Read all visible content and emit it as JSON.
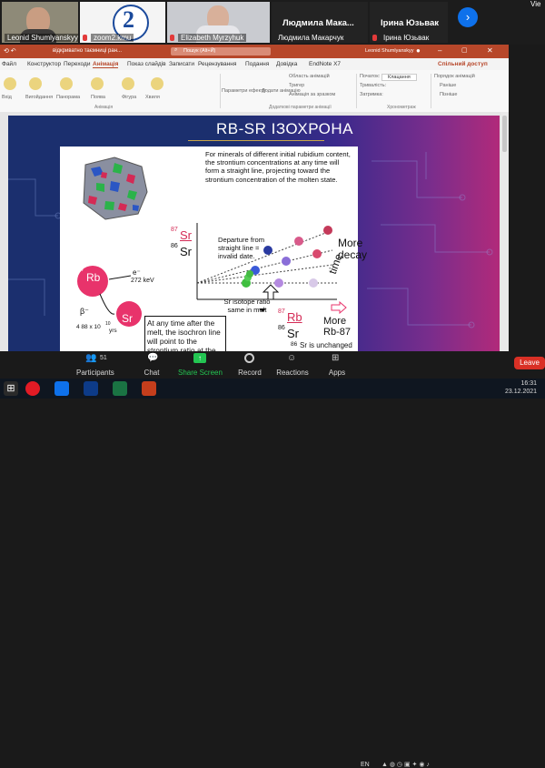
{
  "gallery": {
    "participants": [
      {
        "name": "Leonid Shumlyanskyy"
      },
      {
        "name": "zoom2.kmu"
      },
      {
        "name": "Elizabeth Myrzyhuk"
      },
      {
        "name": "Людмила Макарчук",
        "caption": "Людмила  Мака..."
      },
      {
        "name": "Ірина Юзьвак",
        "caption": "Ірина Юзьвак"
      }
    ],
    "next_label": "›",
    "view_label": "Vie"
  },
  "ppt": {
    "title": "відкриватно таємниці ран...",
    "saved_label": "Пошук (Alt+Й)",
    "user": "Leonid Shumlyanskyy",
    "share_label": "Спільний доступ",
    "tabs": [
      "Файл",
      "Конструктор",
      "Переходи",
      "Анімація",
      "Показ слайдів",
      "Записати",
      "Рецензування",
      "Подання",
      "Довідка",
      "EndNote X7"
    ],
    "ribbon_items": [
      "Вхід",
      "Вигойдання",
      "Панорама",
      "Поява",
      "Фігура",
      "Хвиля",
      "Параметри ефекту",
      "Додати анімацію",
      "Область анімацій",
      "Тригер",
      "Анімація за зразком",
      "Початок:",
      "Клацання",
      "Тривалість:",
      "Затримка:",
      "Порядок анімацій",
      "Раніше",
      "Пізніше"
    ],
    "groups": [
      "Анімація",
      "Додаткові параметри анімації",
      "Хронометраж"
    ]
  },
  "slide": {
    "title": "RB-SR ІЗОХРОНА",
    "paragraph": "For minerals of different initial rubidium content, the strontium concentrations at any time will form a straight line, projecting toward the strontium concentration of the molten state.",
    "sr87": "87",
    "sr": "Sr",
    "sr86": "86",
    "sr_label": "Sr",
    "departure": "Departure from straight line = invalid date.",
    "time": "time",
    "more_decay": "More decay",
    "rb87": "87",
    "rb": "Rb",
    "e_minus": "e⁻",
    "kev": "272 keV",
    "beta": "β⁻",
    "years": "4 88 x 10",
    "years_exp": "10",
    "years_unit": "yrs",
    "sr_iso_label": "Sr isotope ratio same in melt",
    "after_melt": "At any time after the melt, the isochron line will point to the strontium ratio at the time of melt",
    "rb_ratio_num": "87",
    "rb_ratio_sym": "Rb",
    "rb_ratio_den": "86",
    "rb_ratio_den_sym": "Sr",
    "more_rb": "More Rb-87",
    "sr86_note_num": "86",
    "sr86_note": "Sr is unchanged and serves as a stable"
  },
  "controls": {
    "participants_count": "51",
    "items": [
      "Participants",
      "Chat",
      "Share Screen",
      "Record",
      "Reactions",
      "Apps"
    ],
    "leave": "Leave"
  },
  "taskbar": {
    "lang": "EN",
    "time": "16:31",
    "date": "23.12.2021"
  },
  "colors": {
    "ppt_red": "#b7472a",
    "share_green": "#23c552",
    "leave_red": "#d93025"
  }
}
